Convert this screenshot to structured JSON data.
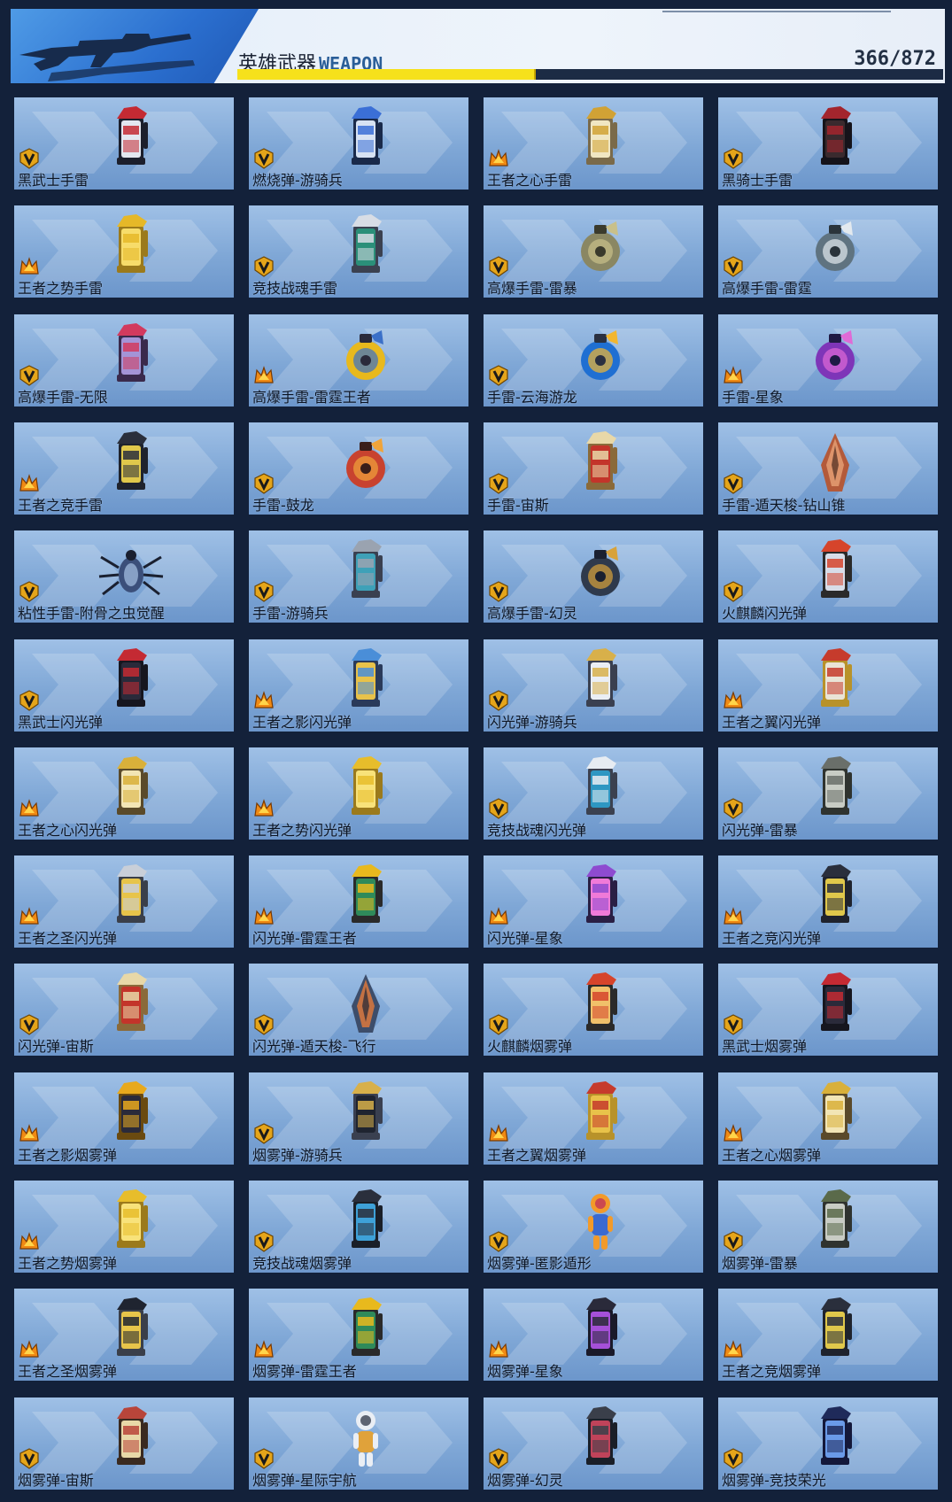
{
  "header": {
    "title_cn": "英雄武器",
    "title_en": "WEAPON",
    "count_current": "366",
    "count_sep": "/",
    "count_total": "872",
    "progress": 0.42
  },
  "colors": {
    "tile_top": "#9fc0e6",
    "tile_bottom": "#6c96cb",
    "progress_fill": "#f6e11b",
    "badge_v": "#e5a51a",
    "badge_crown": "#f08a14"
  },
  "items": [
    {
      "name": "黑武士手雷",
      "badge": "v",
      "art": "canister",
      "c1": "#c42a33",
      "c2": "#e3e7ef",
      "c3": "#1c1f2c"
    },
    {
      "name": "燃烧弹-游骑兵",
      "badge": "v",
      "art": "canister",
      "c1": "#3b6fd6",
      "c2": "#d7e2f3",
      "c3": "#1a2a4a"
    },
    {
      "name": "王者之心手雷",
      "badge": "crown",
      "art": "canister",
      "c1": "#d1a235",
      "c2": "#f0e6c2",
      "c3": "#7a6a4a"
    },
    {
      "name": "黑骑士手雷",
      "badge": "v",
      "art": "canister",
      "c1": "#a3252d",
      "c2": "#3a2a2e",
      "c3": "#15131a"
    },
    {
      "name": "王者之势手雷",
      "badge": "crown",
      "art": "canister",
      "c1": "#e6b828",
      "c2": "#f7dc6a",
      "c3": "#9b7a1c"
    },
    {
      "name": "竞技战魂手雷",
      "badge": "v",
      "art": "canister",
      "c1": "#d8dde5",
      "c2": "#2b8f79",
      "c3": "#3b4150"
    },
    {
      "name": "高爆手雷-雷暴",
      "badge": "v",
      "art": "sphere",
      "c1": "#8a8763",
      "c2": "#c9c08a",
      "c3": "#3a3a2c"
    },
    {
      "name": "高爆手雷-雷霆",
      "badge": "v",
      "art": "sphere",
      "c1": "#5f7380",
      "c2": "#e3e9ee",
      "c3": "#2a343b"
    },
    {
      "name": "高爆手雷-无限",
      "badge": "v",
      "art": "canister",
      "c1": "#d23a5e",
      "c2": "#a494d6",
      "c3": "#3a2a4c"
    },
    {
      "name": "高爆手雷-雷霆王者",
      "badge": "crown",
      "art": "sphere",
      "c1": "#e8b91d",
      "c2": "#3b70c8",
      "c3": "#2a2a3a"
    },
    {
      "name": "手雷-云海游龙",
      "badge": "v",
      "art": "sphere",
      "c1": "#1f6fd2",
      "c2": "#f2b62e",
      "c3": "#2a3040"
    },
    {
      "name": "手雷-星象",
      "badge": "crown",
      "art": "sphere",
      "c1": "#7e35b8",
      "c2": "#e06ad6",
      "c3": "#1f1a44"
    },
    {
      "name": "王者之竞手雷",
      "badge": "crown",
      "art": "canister",
      "c1": "#2a2f3c",
      "c2": "#e0c84b",
      "c3": "#1f232d"
    },
    {
      "name": "手雷-鼓龙",
      "badge": "v",
      "art": "sphere",
      "c1": "#c8422f",
      "c2": "#f0a43a",
      "c3": "#3a1e1a"
    },
    {
      "name": "手雷-宙斯",
      "badge": "v",
      "art": "canister",
      "c1": "#e8d8a8",
      "c2": "#c3342a",
      "c3": "#8a6a3a"
    },
    {
      "name": "手雷-遁天梭-钻山锥",
      "badge": "v",
      "art": "cone",
      "c1": "#b35a3a",
      "c2": "#e7a177",
      "c3": "#4a2a20"
    },
    {
      "name": "粘性手雷-附骨之虫觉醒",
      "badge": "v",
      "art": "bug",
      "c1": "#3b4f7a",
      "c2": "#9bb4d8",
      "c3": "#1a2030"
    },
    {
      "name": "手雷-游骑兵",
      "badge": "v",
      "art": "canister",
      "c1": "#9aa3b0",
      "c2": "#3ea1b8",
      "c3": "#3a4050"
    },
    {
      "name": "高爆手雷-幻灵",
      "badge": "v",
      "art": "sphere",
      "c1": "#2f3a4c",
      "c2": "#d8a23a",
      "c3": "#1a2030"
    },
    {
      "name": "火麒麟闪光弹",
      "badge": "v",
      "art": "canister",
      "c1": "#d6442b",
      "c2": "#d7dde8",
      "c3": "#2a2a2a"
    },
    {
      "name": "黑武士闪光弹",
      "badge": "v",
      "art": "canister",
      "c1": "#c42a33",
      "c2": "#2a2a3a",
      "c3": "#16161f"
    },
    {
      "name": "王者之影闪光弹",
      "badge": "crown",
      "art": "canister",
      "c1": "#4a8ed8",
      "c2": "#e8c24a",
      "c3": "#2a3a5a"
    },
    {
      "name": "闪光弹-游骑兵",
      "badge": "v",
      "art": "canister",
      "c1": "#d8b04a",
      "c2": "#eaeef4",
      "c3": "#3a4050"
    },
    {
      "name": "王者之翼闪光弹",
      "badge": "crown",
      "art": "canister",
      "c1": "#c63b2c",
      "c2": "#e9e4d6",
      "c3": "#b8922a"
    },
    {
      "name": "王者之心闪光弹",
      "badge": "crown",
      "art": "canister",
      "c1": "#d9b03a",
      "c2": "#f2e5b5",
      "c3": "#5a4a2a"
    },
    {
      "name": "王者之势闪光弹",
      "badge": "crown",
      "art": "canister",
      "c1": "#e7bd2b",
      "c2": "#f8e27a",
      "c3": "#9b7a1c"
    },
    {
      "name": "竞技战魂闪光弹",
      "badge": "v",
      "art": "canister",
      "c1": "#e7ecf2",
      "c2": "#2e97c2",
      "c3": "#3b4150"
    },
    {
      "name": "闪光弹-雷暴",
      "badge": "v",
      "art": "canister",
      "c1": "#6a6f6a",
      "c2": "#c8ccc4",
      "c3": "#2f332f"
    },
    {
      "name": "王者之圣闪光弹",
      "badge": "crown",
      "art": "canister",
      "c1": "#c9cfd8",
      "c2": "#e7c44a",
      "c3": "#3a3f4a"
    },
    {
      "name": "闪光弹-雷霆王者",
      "badge": "crown",
      "art": "canister",
      "c1": "#e8b91d",
      "c2": "#2f8a5a",
      "c3": "#2a2a2a"
    },
    {
      "name": "闪光弹-星象",
      "badge": "crown",
      "art": "canister",
      "c1": "#8e4bd0",
      "c2": "#f07ad8",
      "c3": "#2a1f44"
    },
    {
      "name": "王者之竞闪光弹",
      "badge": "crown",
      "art": "canister",
      "c1": "#2a2f3c",
      "c2": "#e0c84b",
      "c3": "#1f232d"
    },
    {
      "name": "闪光弹-宙斯",
      "badge": "v",
      "art": "canister",
      "c1": "#e8d8a8",
      "c2": "#c3342a",
      "c3": "#8a6a3a"
    },
    {
      "name": "闪光弹-遁天梭-飞行",
      "badge": "v",
      "art": "cone",
      "c1": "#3d4d6a",
      "c2": "#e57a3a",
      "c3": "#1e2636"
    },
    {
      "name": "火麒麟烟雾弹",
      "badge": "v",
      "art": "canister",
      "c1": "#d6442b",
      "c2": "#f0c06a",
      "c3": "#2a2a2a"
    },
    {
      "name": "黑武士烟雾弹",
      "badge": "v",
      "art": "canister",
      "c1": "#c42a33",
      "c2": "#2a2a3a",
      "c3": "#16161f"
    },
    {
      "name": "王者之影烟雾弹",
      "badge": "crown",
      "art": "canister",
      "c1": "#e8a91d",
      "c2": "#2a2a3a",
      "c3": "#6a4a10"
    },
    {
      "name": "烟雾弹-游骑兵",
      "badge": "v",
      "art": "canister",
      "c1": "#d8b04a",
      "c2": "#1f2430",
      "c3": "#3a4050"
    },
    {
      "name": "王者之翼烟雾弹",
      "badge": "crown",
      "art": "canister",
      "c1": "#c63b2c",
      "c2": "#e8c24a",
      "c3": "#b8922a"
    },
    {
      "name": "王者之心烟雾弹",
      "badge": "crown",
      "art": "canister",
      "c1": "#d9b03a",
      "c2": "#f2e5b5",
      "c3": "#5a4a2a"
    },
    {
      "name": "王者之势烟雾弹",
      "badge": "crown",
      "art": "canister",
      "c1": "#e7bd2b",
      "c2": "#f8e27a",
      "c3": "#9b7a1c"
    },
    {
      "name": "竞技战魂烟雾弹",
      "badge": "v",
      "art": "canister",
      "c1": "#2a2f3c",
      "c2": "#3ea1d8",
      "c3": "#1a1f28"
    },
    {
      "name": "烟雾弹-匿影遁形",
      "badge": "v",
      "art": "figure",
      "c1": "#f29a2a",
      "c2": "#3a6ad0",
      "c3": "#c0355a"
    },
    {
      "name": "烟雾弹-雷暴",
      "badge": "v",
      "art": "canister",
      "c1": "#5a6a4a",
      "c2": "#c8ccc4",
      "c3": "#2f332f"
    },
    {
      "name": "王者之圣烟雾弹",
      "badge": "crown",
      "art": "canister",
      "c1": "#1f2430",
      "c2": "#e7c44a",
      "c3": "#3a3f4a"
    },
    {
      "name": "烟雾弹-雷霆王者",
      "badge": "crown",
      "art": "canister",
      "c1": "#e8b91d",
      "c2": "#2f8a5a",
      "c3": "#2a2a2a"
    },
    {
      "name": "烟雾弹-星象",
      "badge": "crown",
      "art": "canister",
      "c1": "#2a2a3a",
      "c2": "#a550d8",
      "c3": "#1a1a2a"
    },
    {
      "name": "王者之竞烟雾弹",
      "badge": "crown",
      "art": "canister",
      "c1": "#2a2f3c",
      "c2": "#e0c84b",
      "c3": "#1f232d"
    },
    {
      "name": "烟雾弹-宙斯",
      "badge": "v",
      "art": "canister",
      "c1": "#b8453a",
      "c2": "#e8d8a8",
      "c3": "#3a2a20"
    },
    {
      "name": "烟雾弹-星际宇航",
      "badge": "v",
      "art": "figure",
      "c1": "#eaeef4",
      "c2": "#e0a23a",
      "c3": "#3a4050"
    },
    {
      "name": "烟雾弹-幻灵",
      "badge": "v",
      "art": "canister",
      "c1": "#3a3f4a",
      "c2": "#c0435a",
      "c3": "#1a1f28"
    },
    {
      "name": "烟雾弹-竞技荣光",
      "badge": "v",
      "art": "canister",
      "c1": "#1f2a5a",
      "c2": "#6a9ae8",
      "c3": "#14183a"
    }
  ]
}
